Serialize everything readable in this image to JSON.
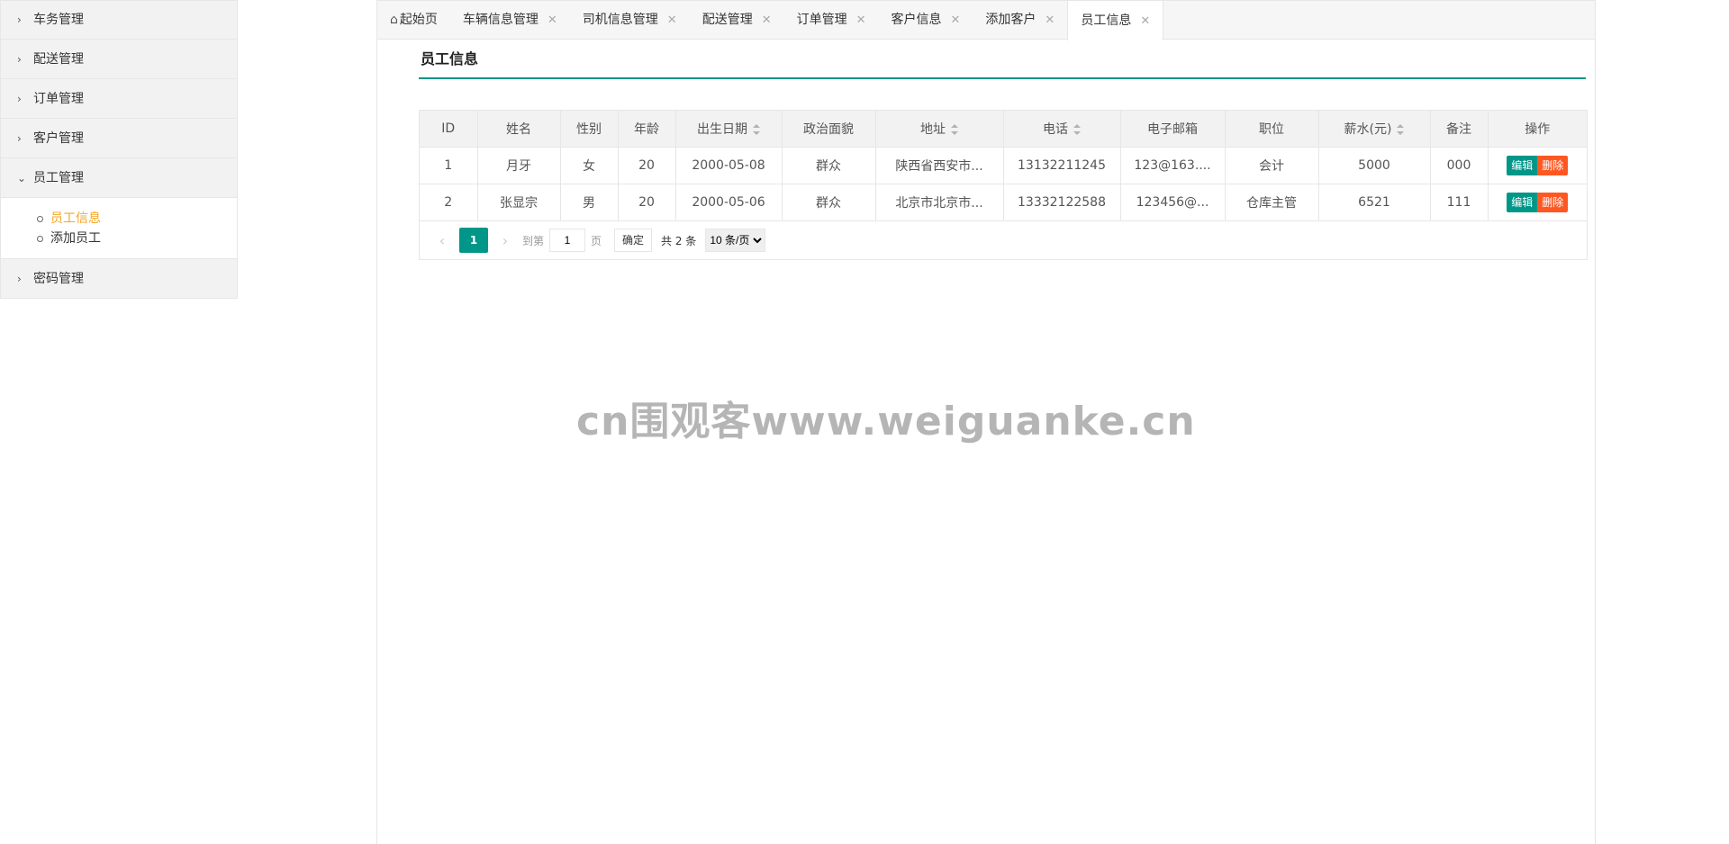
{
  "sidebar": {
    "groups": [
      {
        "label": "车务管理",
        "chev": "›"
      },
      {
        "label": "配送管理",
        "chev": "›"
      },
      {
        "label": "订单管理",
        "chev": "›"
      },
      {
        "label": "客户管理",
        "chev": "›"
      },
      {
        "label": "员工管理",
        "chev": "⌄"
      },
      {
        "label": "密码管理",
        "chev": "›"
      }
    ],
    "sub_items": [
      {
        "label": "员工信息",
        "active": true
      },
      {
        "label": "添加员工",
        "active": false
      }
    ]
  },
  "tabs": [
    {
      "label": "起始页",
      "closable": false,
      "icon": "home-icon"
    },
    {
      "label": "车辆信息管理",
      "closable": true
    },
    {
      "label": "司机信息管理",
      "closable": true
    },
    {
      "label": "配送管理",
      "closable": true
    },
    {
      "label": "订单管理",
      "closable": true
    },
    {
      "label": "客户信息",
      "closable": true
    },
    {
      "label": "添加客户",
      "closable": true
    },
    {
      "label": "员工信息",
      "closable": true,
      "active": true
    }
  ],
  "page": {
    "title": "员工信息"
  },
  "table": {
    "columns": [
      "ID",
      "姓名",
      "性别",
      "年龄",
      "出生日期",
      "政治面貌",
      "地址",
      "电话",
      "电子邮箱",
      "职位",
      "薪水(元)",
      "备注",
      "操作"
    ],
    "rows": [
      [
        "1",
        "月牙",
        "女",
        "20",
        "2000-05-08",
        "群众",
        "陕西省西安市...",
        "13132211245",
        "123@163....",
        "会计",
        "5000",
        "000"
      ],
      [
        "2",
        "张显宗",
        "男",
        "20",
        "2000-05-06",
        "群众",
        "北京市北京市...",
        "13332122588",
        "123456@...",
        "仓库主管",
        "6521",
        "111"
      ]
    ],
    "edit_label": "编辑",
    "delete_label": "删除"
  },
  "pager": {
    "current": "1",
    "goto_label": "到第",
    "goto_value": "1",
    "page_label": "页",
    "confirm_label": "确定",
    "total_label": "共 2 条",
    "per_page": "10 条/页"
  },
  "watermark": "cn围观客www.weiguanke.cn",
  "colors": {
    "accent": "#009688",
    "danger": "#ff5722",
    "active_sub": "#f5a623"
  }
}
